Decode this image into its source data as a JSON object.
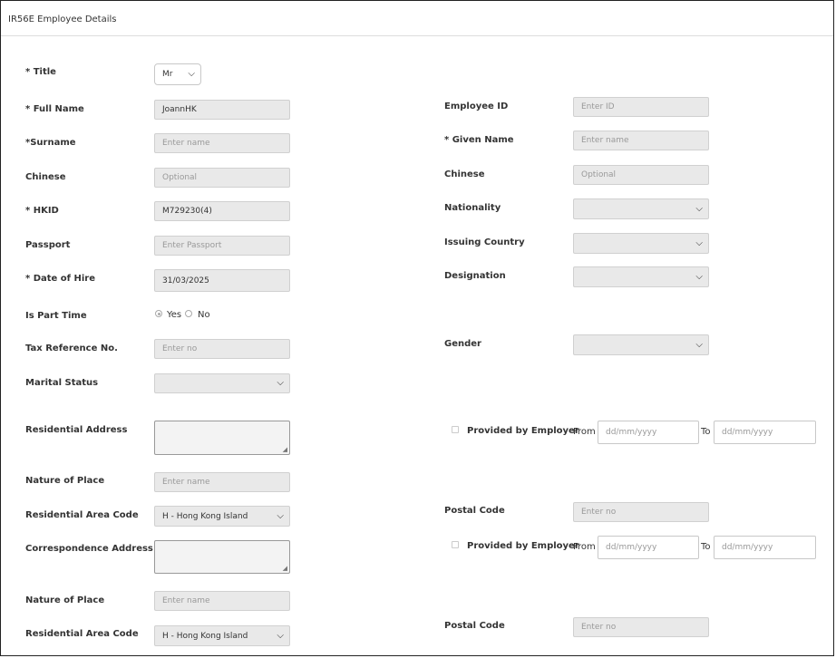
{
  "panel": {
    "title": "IR56E Employee Details"
  },
  "left": {
    "title": {
      "label": "* Title",
      "value": "Mr"
    },
    "full_name": {
      "label": "* Full Name",
      "value": "JoannHK"
    },
    "surname": {
      "label": "*Surname",
      "placeholder": "Enter name"
    },
    "chinese": {
      "label": "Chinese",
      "placeholder": "Optional"
    },
    "hkid": {
      "label": "* HKID",
      "value": "M729230(4)"
    },
    "passport": {
      "label": "Passport",
      "placeholder": "Enter Passport"
    },
    "date_of_hire": {
      "label": "* Date of Hire",
      "value": "31/03/2025"
    },
    "part_time": {
      "label": "Is Part Time",
      "yes": "Yes",
      "no": "No",
      "selected": "Yes"
    },
    "tax_ref": {
      "label": "Tax Reference No.",
      "placeholder": "Enter no"
    },
    "marital_status": {
      "label": "Marital Status",
      "value": ""
    },
    "residential_address": {
      "label": "Residential Address"
    },
    "nature_of_place_1": {
      "label": "Nature of Place",
      "placeholder": "Enter name"
    },
    "residential_area_code_1": {
      "label": "Residential Area Code",
      "value": "H - Hong Kong Island"
    },
    "correspondence_address": {
      "label": "Correspondence Address"
    },
    "nature_of_place_2": {
      "label": "Nature of Place",
      "placeholder": "Enter name"
    },
    "residential_area_code_2": {
      "label": "Residential Area Code",
      "value": "H - Hong Kong Island"
    }
  },
  "right": {
    "employee_id": {
      "label": "Employee ID",
      "placeholder": "Enter ID"
    },
    "given_name": {
      "label": "* Given Name",
      "placeholder": "Enter name"
    },
    "chinese": {
      "label": "Chinese",
      "placeholder": "Optional"
    },
    "nationality": {
      "label": "Nationality",
      "value": ""
    },
    "issuing_country": {
      "label": "Issuing Country",
      "value": ""
    },
    "designation": {
      "label": "Designation",
      "value": ""
    },
    "gender": {
      "label": "Gender",
      "value": ""
    },
    "provided_1": {
      "label": "Provided by Employer",
      "from": "From",
      "to": "To",
      "from_placeholder": "dd/mm/yyyy",
      "to_placeholder": "dd/mm/yyyy"
    },
    "postal_code_1": {
      "label": "Postal Code",
      "placeholder": "Enter no"
    },
    "provided_2": {
      "label": "Provided by Employer",
      "from": "From",
      "to": "To",
      "from_placeholder": "dd/mm/yyyy",
      "to_placeholder": "dd/mm/yyyy"
    },
    "postal_code_2": {
      "label": "Postal Code",
      "placeholder": "Enter no"
    }
  },
  "icons": {
    "dropdown": "chevron-down-icon"
  }
}
